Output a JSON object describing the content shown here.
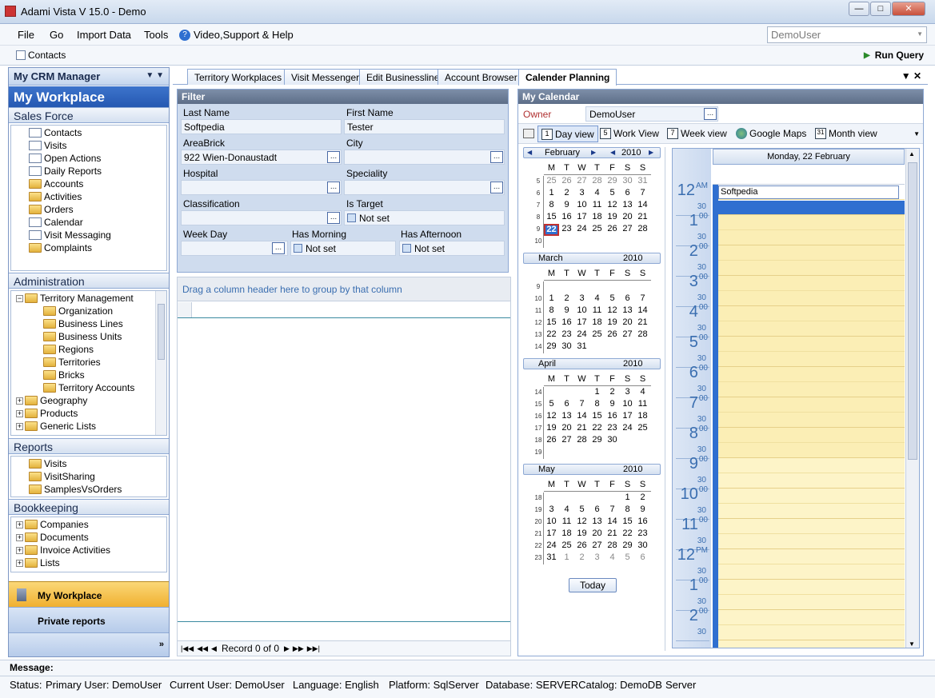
{
  "window": {
    "title": "Adami Vista V 15.0 - Demo"
  },
  "menu": {
    "file": "File",
    "go": "Go",
    "import": "Import Data",
    "tools": "Tools",
    "help": "Video,Support & Help",
    "user": "DemoUser"
  },
  "toolbar": {
    "contacts": "Contacts",
    "run_query": "Run Query"
  },
  "left": {
    "title": "My CRM Manager",
    "workplace": "My Workplace",
    "sales_force": "Sales Force",
    "sales_items": [
      "Contacts",
      "Visits",
      "Open Actions",
      "Daily Reports",
      "Accounts",
      "Activities",
      "Orders",
      "Calendar",
      "Visit Messaging",
      "Complaints"
    ],
    "administration": "Administration",
    "admin_root": "Territory Management",
    "admin_children": [
      "Organization",
      "Business Lines",
      "Business Units",
      "Regions",
      "Territories",
      "Bricks",
      "Territory Accounts"
    ],
    "admin_more": [
      "Geography",
      "Products",
      "Generic Lists"
    ],
    "reports": "Reports",
    "report_items": [
      "Visits",
      "VisitSharing",
      "SamplesVsOrders"
    ],
    "bookkeeping": "Bookkeeping",
    "book_items": [
      "Companies",
      "Documents",
      "Invoice Activities",
      "Lists"
    ],
    "nav_workplace": "My Workplace",
    "nav_private": "Private reports"
  },
  "tabs": [
    "Territory Workplaces",
    "Visit Messenger",
    "Edit Businessline",
    "Account Browser",
    "Calender Planning"
  ],
  "filter": {
    "title": "Filter",
    "last_name_lbl": "Last Name",
    "last_name": "Softpedia",
    "first_name_lbl": "First Name",
    "first_name": "Tester",
    "areabrick_lbl": "AreaBrick",
    "areabrick": "922 Wien-Donaustadt",
    "city_lbl": "City",
    "hospital_lbl": "Hospital",
    "speciality_lbl": "Speciality",
    "classification_lbl": "Classification",
    "is_target_lbl": "Is Target",
    "not_set": "Not set",
    "week_day_lbl": "Week Day",
    "has_morning_lbl": "Has Morning",
    "has_afternoon_lbl": "Has Afternoon"
  },
  "grid": {
    "group_hint": "Drag a column header here to group by that column",
    "record": "Record 0 of 0"
  },
  "calendar": {
    "title": "My Calendar",
    "owner_lbl": "Owner",
    "owner": "DemoUser",
    "views": [
      "Day view",
      "Work View",
      "Week view",
      "Google Maps",
      "Month view"
    ],
    "day_header": "Monday, 22 February",
    "event": "Softpedia",
    "today_btn": "Today",
    "weekdays": [
      "M",
      "T",
      "W",
      "T",
      "F",
      "S",
      "S"
    ],
    "months": [
      {
        "name": "February",
        "year": "2010",
        "weeks": [
          "5",
          "6",
          "7",
          "8",
          "9",
          "10"
        ],
        "days": [
          [
            "25",
            "26",
            "27",
            "28",
            "29",
            "30",
            "31"
          ],
          [
            "1",
            "2",
            "3",
            "4",
            "5",
            "6",
            "7"
          ],
          [
            "8",
            "9",
            "10",
            "11",
            "12",
            "13",
            "14"
          ],
          [
            "15",
            "16",
            "17",
            "18",
            "19",
            "20",
            "21"
          ],
          [
            "22",
            "23",
            "24",
            "25",
            "26",
            "27",
            "28"
          ],
          [
            "",
            "",
            "",
            "",
            "",
            "",
            ""
          ]
        ]
      },
      {
        "name": "March",
        "year": "2010",
        "weeks": [
          "9",
          "10",
          "11",
          "12",
          "13",
          "14"
        ],
        "days": [
          [
            "",
            "",
            "",
            "",
            "",
            "",
            ""
          ],
          [
            "1",
            "2",
            "3",
            "4",
            "5",
            "6",
            "7"
          ],
          [
            "8",
            "9",
            "10",
            "11",
            "12",
            "13",
            "14"
          ],
          [
            "15",
            "16",
            "17",
            "18",
            "19",
            "20",
            "21"
          ],
          [
            "22",
            "23",
            "24",
            "25",
            "26",
            "27",
            "28"
          ],
          [
            "29",
            "30",
            "31",
            "",
            "",
            "",
            ""
          ]
        ]
      },
      {
        "name": "April",
        "year": "2010",
        "weeks": [
          "14",
          "15",
          "16",
          "17",
          "18",
          "19"
        ],
        "days": [
          [
            "",
            "",
            "",
            "1",
            "2",
            "3",
            "4"
          ],
          [
            "5",
            "6",
            "7",
            "8",
            "9",
            "10",
            "11"
          ],
          [
            "12",
            "13",
            "14",
            "15",
            "16",
            "17",
            "18"
          ],
          [
            "19",
            "20",
            "21",
            "22",
            "23",
            "24",
            "25"
          ],
          [
            "26",
            "27",
            "28",
            "29",
            "30",
            "",
            ""
          ],
          [
            "",
            "",
            "",
            "",
            "",
            "",
            ""
          ]
        ]
      },
      {
        "name": "May",
        "year": "2010",
        "weeks": [
          "18",
          "19",
          "20",
          "21",
          "22",
          "23"
        ],
        "days": [
          [
            "",
            "",
            "",
            "",
            "",
            "1",
            "2"
          ],
          [
            "3",
            "4",
            "5",
            "6",
            "7",
            "8",
            "9"
          ],
          [
            "10",
            "11",
            "12",
            "13",
            "14",
            "15",
            "16"
          ],
          [
            "17",
            "18",
            "19",
            "20",
            "21",
            "22",
            "23"
          ],
          [
            "24",
            "25",
            "26",
            "27",
            "28",
            "29",
            "30"
          ],
          [
            "31",
            "1",
            "2",
            "3",
            "4",
            "5",
            "6"
          ]
        ]
      }
    ],
    "hours": [
      {
        "h": "12",
        "s": "AM"
      },
      {
        "h": "1",
        "s": "00"
      },
      {
        "h": "2",
        "s": "00"
      },
      {
        "h": "3",
        "s": "00"
      },
      {
        "h": "4",
        "s": "00"
      },
      {
        "h": "5",
        "s": "00"
      },
      {
        "h": "6",
        "s": "00"
      },
      {
        "h": "7",
        "s": "00"
      },
      {
        "h": "8",
        "s": "00"
      },
      {
        "h": "9",
        "s": "00"
      },
      {
        "h": "10",
        "s": "00"
      },
      {
        "h": "11",
        "s": "00"
      },
      {
        "h": "12",
        "s": "PM"
      },
      {
        "h": "1",
        "s": "00"
      },
      {
        "h": "2",
        "s": "00"
      }
    ],
    "half": "30"
  },
  "status": {
    "message_lbl": "Message:",
    "status": "Status:",
    "primary_user": "Primary User: DemoUser",
    "current_user": "Current User: DemoUser",
    "language": "Language: English",
    "platform": "Platform: SqlServer",
    "database": "Database: SERVERCatalog: DemoDB",
    "server": "Server"
  },
  "colors": {
    "accent": "#2f6fd0",
    "nav_active": "#f5c141",
    "workhours": "#fbeeb5"
  }
}
